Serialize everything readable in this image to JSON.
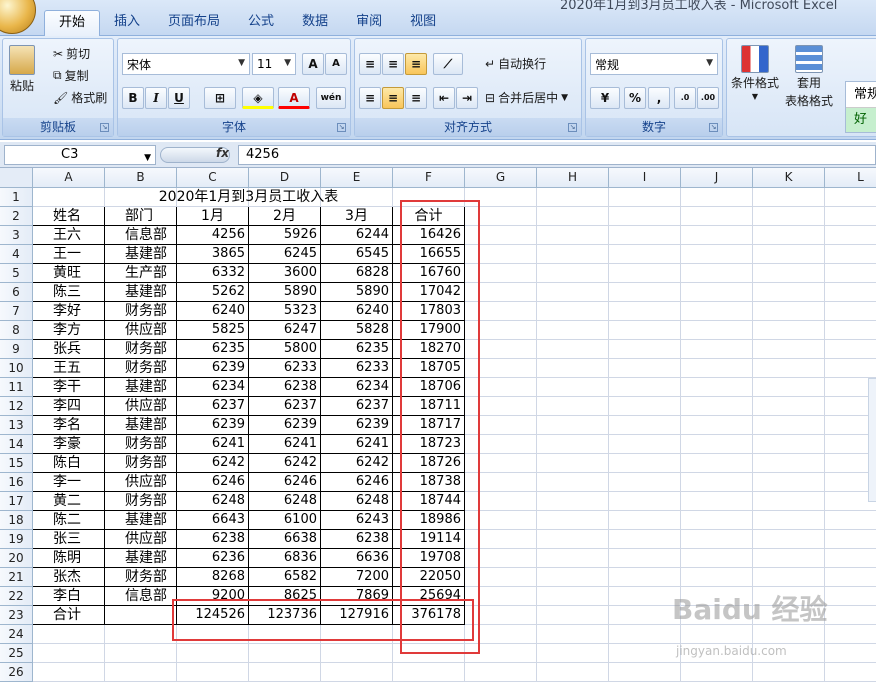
{
  "window": {
    "title": "2020年1月到3月员工收入表 - Microsoft Excel"
  },
  "tabs": [
    "开始",
    "插入",
    "页面布局",
    "公式",
    "数据",
    "审阅",
    "视图"
  ],
  "ribbon": {
    "clipboard": {
      "label": "剪贴板",
      "paste": "粘贴",
      "cut": "剪切",
      "copy": "复制",
      "format_painter": "格式刷"
    },
    "font": {
      "label": "字体",
      "name": "宋体",
      "size": "11",
      "bold": "B",
      "italic": "I",
      "underline": "U",
      "grow": "A",
      "shrink": "A",
      "phonetic": "wén"
    },
    "alignment": {
      "label": "对齐方式",
      "wrap": "自动换行",
      "merge": "合并后居中"
    },
    "number": {
      "label": "数字",
      "format": "常规",
      "percent": "%",
      "comma": ","
    },
    "styles": {
      "conditional": "条件格式",
      "table_format_1": "套用",
      "table_format_2": "表格格式",
      "normal": "常规",
      "good": "好"
    }
  },
  "formula_bar": {
    "name_box": "C3",
    "fx": "fx",
    "formula": "4256"
  },
  "columns": [
    "A",
    "B",
    "C",
    "D",
    "E",
    "F",
    "G",
    "H",
    "I",
    "J",
    "K",
    "L"
  ],
  "row_numbers": [
    "1",
    "2",
    "3",
    "4",
    "5",
    "6",
    "7",
    "8",
    "9",
    "10",
    "11",
    "12",
    "13",
    "14",
    "15",
    "16",
    "17",
    "18",
    "19",
    "20",
    "21",
    "22",
    "23",
    "24",
    "25",
    "26"
  ],
  "sheet": {
    "title": "2020年1月到3月员工收入表",
    "headers": [
      "姓名",
      "部门",
      "1月",
      "2月",
      "3月",
      "合计"
    ],
    "rows": [
      [
        "王六",
        "信息部",
        "4256",
        "5926",
        "6244",
        "16426"
      ],
      [
        "王一",
        "基建部",
        "3865",
        "6245",
        "6545",
        "16655"
      ],
      [
        "黄旺",
        "生产部",
        "6332",
        "3600",
        "6828",
        "16760"
      ],
      [
        "陈三",
        "基建部",
        "5262",
        "5890",
        "5890",
        "17042"
      ],
      [
        "李好",
        "财务部",
        "6240",
        "5323",
        "6240",
        "17803"
      ],
      [
        "李方",
        "供应部",
        "5825",
        "6247",
        "5828",
        "17900"
      ],
      [
        "张兵",
        "财务部",
        "6235",
        "5800",
        "6235",
        "18270"
      ],
      [
        "王五",
        "财务部",
        "6239",
        "6233",
        "6233",
        "18705"
      ],
      [
        "李干",
        "基建部",
        "6234",
        "6238",
        "6234",
        "18706"
      ],
      [
        "李四",
        "供应部",
        "6237",
        "6237",
        "6237",
        "18711"
      ],
      [
        "李名",
        "基建部",
        "6239",
        "6239",
        "6239",
        "18717"
      ],
      [
        "李豪",
        "财务部",
        "6241",
        "6241",
        "6241",
        "18723"
      ],
      [
        "陈白",
        "财务部",
        "6242",
        "6242",
        "6242",
        "18726"
      ],
      [
        "李一",
        "供应部",
        "6246",
        "6246",
        "6246",
        "18738"
      ],
      [
        "黄二",
        "财务部",
        "6248",
        "6248",
        "6248",
        "18744"
      ],
      [
        "陈二",
        "基建部",
        "6643",
        "6100",
        "6243",
        "18986"
      ],
      [
        "张三",
        "供应部",
        "6238",
        "6638",
        "6238",
        "19114"
      ],
      [
        "陈明",
        "基建部",
        "6236",
        "6836",
        "6636",
        "19708"
      ],
      [
        "张杰",
        "财务部",
        "8268",
        "6582",
        "7200",
        "22050"
      ],
      [
        "李白",
        "信息部",
        "9200",
        "8625",
        "7869",
        "25694"
      ]
    ],
    "total_row": [
      "合计",
      "",
      "124526",
      "123736",
      "127916",
      "376178"
    ]
  },
  "watermark": {
    "logo": "Baidu 经验",
    "url": "jingyan.baidu.com"
  },
  "colors": {
    "highlight_border": "#e03a3a",
    "ribbon_label": "#15428b"
  }
}
